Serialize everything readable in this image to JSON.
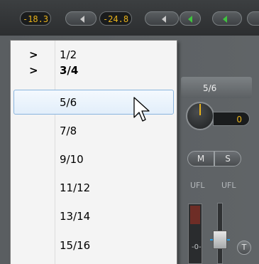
{
  "toolbar": {
    "level_left": "-18.3",
    "level_right": "-24.8"
  },
  "channel": {
    "name": "5/6",
    "gain_value": "0",
    "mute_label": "M",
    "solo_label": "S",
    "ufl_left": "UFL",
    "ufl_right": "UFL",
    "fader_scale_label": "-0-",
    "trim_label": "T"
  },
  "menu": {
    "items": [
      {
        "label": "1/2",
        "has_submenu": true,
        "bold": false,
        "highlighted": false
      },
      {
        "label": "3/4",
        "has_submenu": true,
        "bold": true,
        "highlighted": false
      },
      {
        "label": "5/6",
        "has_submenu": false,
        "bold": false,
        "highlighted": true
      },
      {
        "label": "7/8",
        "has_submenu": false,
        "bold": false,
        "highlighted": false
      },
      {
        "label": "9/10",
        "has_submenu": false,
        "bold": false,
        "highlighted": false
      },
      {
        "label": "11/12",
        "has_submenu": false,
        "bold": false,
        "highlighted": false
      },
      {
        "label": "13/14",
        "has_submenu": false,
        "bold": false,
        "highlighted": false
      },
      {
        "label": "15/16",
        "has_submenu": false,
        "bold": false,
        "highlighted": false
      }
    ],
    "submenu_icon": "chevron-right-icon"
  },
  "colors": {
    "level_text": "#e8b21a",
    "play_green": "#3fc33f",
    "highlight_border": "#8ab5de"
  }
}
